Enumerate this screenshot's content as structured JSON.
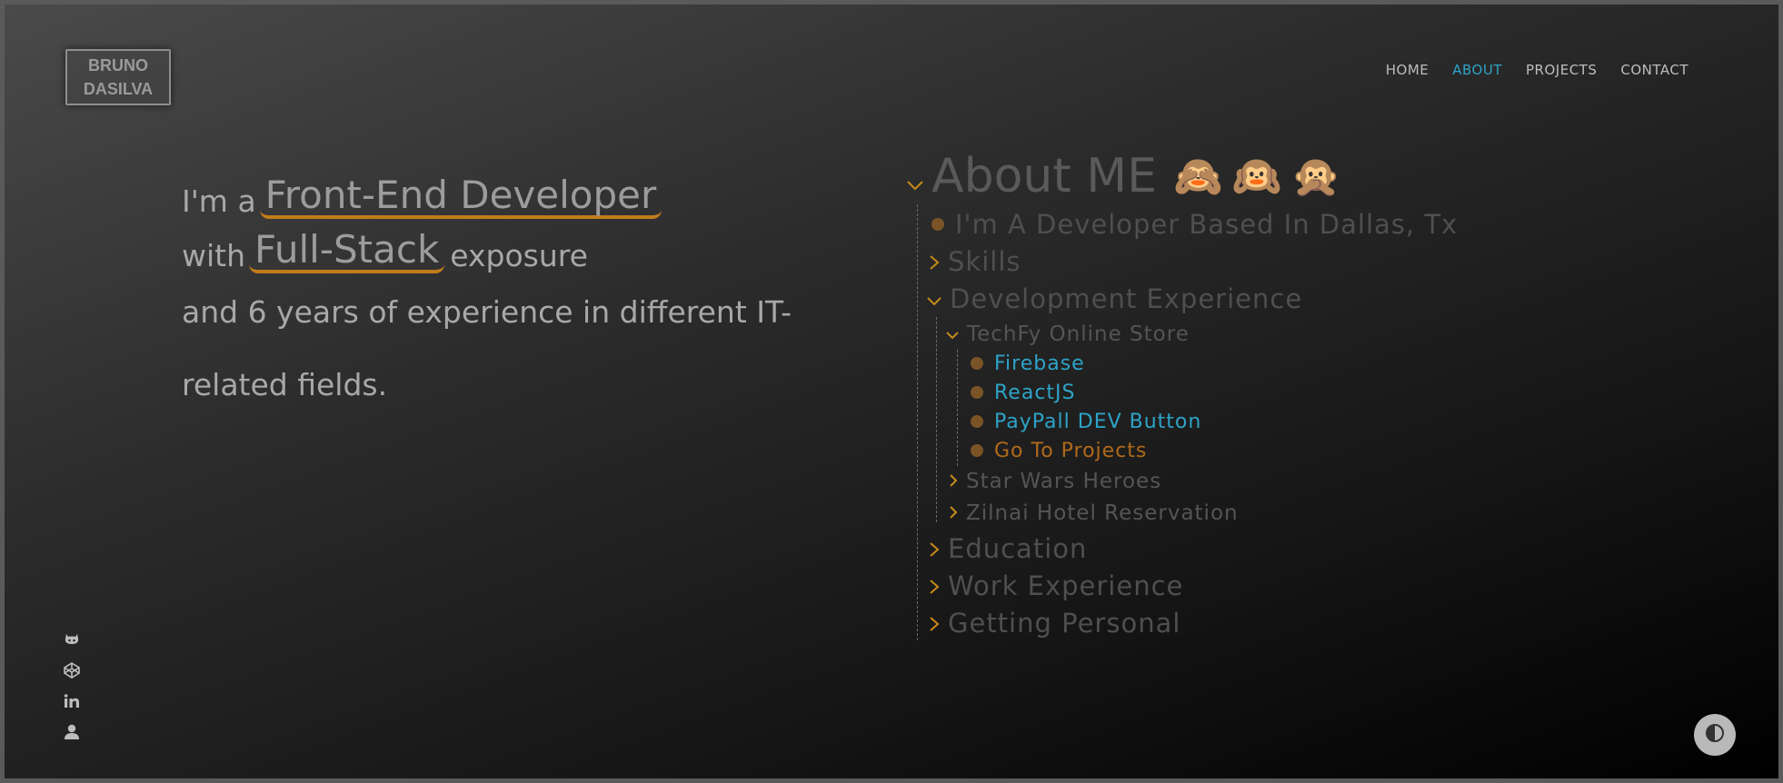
{
  "logo": {
    "line1": "BRUNO",
    "line2": "DASILVA"
  },
  "nav": {
    "items": [
      "HOME",
      "ABOUT",
      "PROJECTS",
      "CONTACT"
    ],
    "active": "ABOUT"
  },
  "intro": {
    "prefix": "I'm a",
    "role": "Front-End Developer",
    "with": "with",
    "stack": "Full-Stack",
    "exposure": "exposure",
    "line3": "and 6 years of experience in different IT-",
    "line4": "related fields."
  },
  "social": {
    "icons": [
      "github-icon",
      "codepen-icon",
      "linkedin-icon",
      "user-icon"
    ]
  },
  "about": {
    "title": "About ME",
    "emoji": "🙈🙉🙊",
    "location": "I'm A Developer Based In Dallas, Tx",
    "skills": "Skills",
    "dev_experience": "Development Experience",
    "project": "TechFy Online Store",
    "project_items": [
      "Firebase",
      "ReactJS",
      "PayPall DEV Button",
      "Go To Projects"
    ],
    "star_wars": "Star Wars Heroes",
    "hotel": "Zilnai Hotel Reservation",
    "education": "Education",
    "work": "Work Experience",
    "personal": "Getting Personal"
  },
  "colors": {
    "accent": "#2ea3c7",
    "underline": "#c27c1a",
    "chevron": "#c88a1c",
    "bullet": "#7a5326"
  }
}
